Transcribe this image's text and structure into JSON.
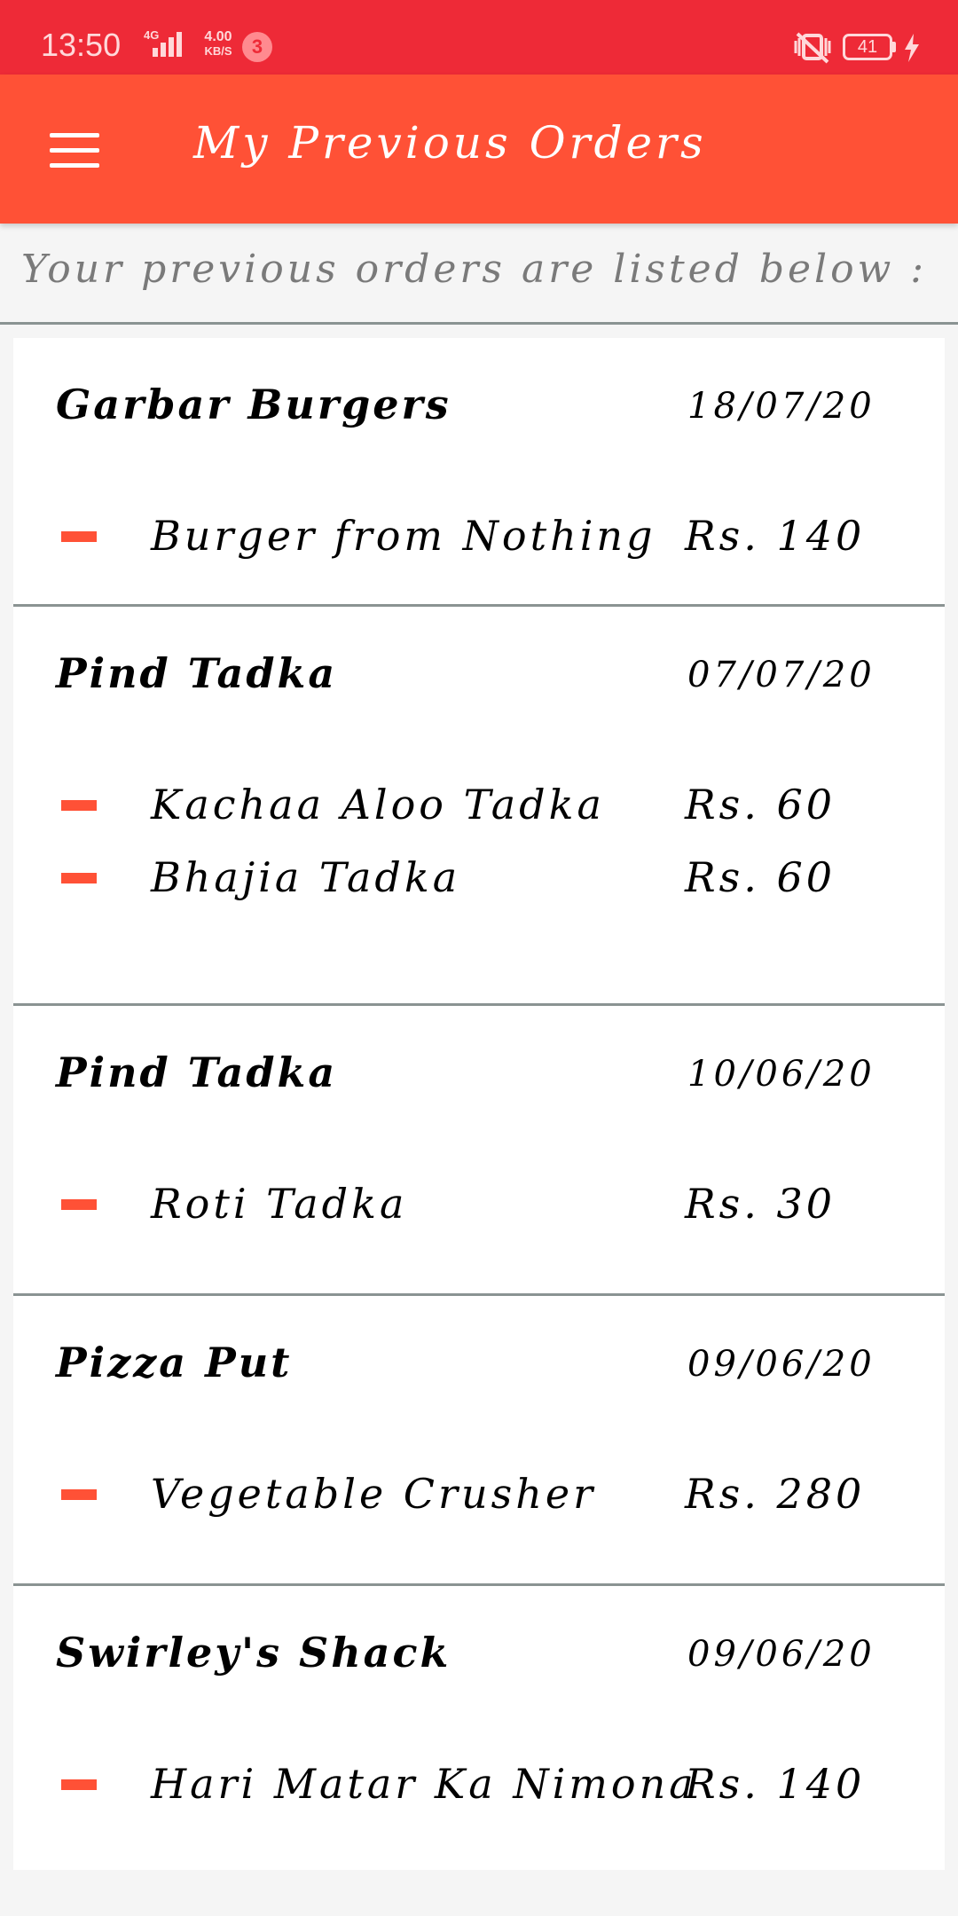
{
  "status_bar": {
    "time": "13:50",
    "network": "4G",
    "speed_value": "4.00",
    "speed_unit": "KB/S",
    "notification_count": "3",
    "battery": "41"
  },
  "app_bar": {
    "title": "My Previous Orders",
    "menu_icon": "hamburger-menu-icon"
  },
  "subheading": "Your previous orders are listed below :",
  "colors": {
    "status_bar": "#ee2a37",
    "app_bar": "#ff5136",
    "accent_dash": "#ff5136",
    "divider": "#8a9392"
  },
  "orders": [
    {
      "restaurant": "Garbar Burgers",
      "date": "18/07/20",
      "items": [
        {
          "name": "Burger from Nothing",
          "price": "Rs. 140"
        }
      ]
    },
    {
      "restaurant": "Pind Tadka",
      "date": "07/07/20",
      "items": [
        {
          "name": "Kachaa Aloo Tadka",
          "price": "Rs. 60"
        },
        {
          "name": "Bhajia Tadka",
          "price": "Rs. 60"
        }
      ]
    },
    {
      "restaurant": "Pind Tadka",
      "date": "10/06/20",
      "items": [
        {
          "name": "Roti Tadka",
          "price": "Rs. 30"
        }
      ]
    },
    {
      "restaurant": "Pizza Put",
      "date": "09/06/20",
      "items": [
        {
          "name": "Vegetable Crusher",
          "price": "Rs. 280"
        }
      ]
    },
    {
      "restaurant": "Swirley's Shack",
      "date": "09/06/20",
      "items": [
        {
          "name": "Hari Matar Ka Nimona",
          "price": "Rs. 140"
        }
      ]
    }
  ]
}
